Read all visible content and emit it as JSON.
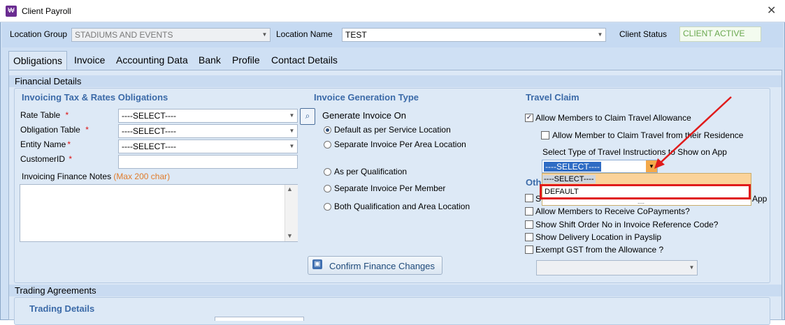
{
  "window": {
    "title": "Client Payroll",
    "close_glyph": "✕"
  },
  "topbar": {
    "location_group_label": "Location Group",
    "location_group_value": "STADIUMS AND EVENTS",
    "location_name_label": "Location Name",
    "location_name_value": "TEST",
    "client_status_label": "Client Status",
    "client_status_value": "CLIENT ACTIVE"
  },
  "tabs": [
    {
      "label": "Obligations",
      "active": true
    },
    {
      "label": "Invoice"
    },
    {
      "label": "Accounting Data"
    },
    {
      "label": "Bank"
    },
    {
      "label": "Profile"
    },
    {
      "label": "Contact Details"
    }
  ],
  "financial": {
    "section_title": "Financial Details",
    "tax_group_title": "Invoicing Tax & Rates Obligations",
    "rate_table_label": "Rate Table",
    "rate_table_value": "----SELECT----",
    "obligation_table_label": "Obligation Table",
    "obligation_table_value": "----SELECT----",
    "entity_name_label": "Entity Name",
    "entity_name_value": "----SELECT----",
    "customer_id_label": "CustomerID",
    "customer_id_value": "",
    "required_mark": "*",
    "notes_label": "Invoicing Finance Notes",
    "notes_hint": "(Max 200 char)",
    "notes_value": "",
    "confirm_button": "Confirm Finance Changes"
  },
  "invoice_generation": {
    "title": "Invoice Generation Type",
    "subtitle": "Generate Invoice On",
    "options": [
      {
        "label": "Default as per Service Location",
        "selected": true
      },
      {
        "label": "Separate Invoice Per Area Location",
        "selected": false
      },
      {
        "label": "As per Qualification",
        "selected": false
      },
      {
        "label": "Separate Invoice Per Member",
        "selected": false
      },
      {
        "label": "Both Qualification and Area Location",
        "selected": false
      }
    ]
  },
  "travel_claim": {
    "title": "Travel Claim",
    "allow_travel_label": "Allow Members to Claim Travel Allowance",
    "allow_travel_checked": true,
    "allow_residence_label": "Allow Member to Claim Travel from their Residence",
    "allow_residence_checked": false,
    "instruction_label": "Select Type of Travel Instructions to Show on App",
    "instruction_value": "----SELECT----",
    "dropdown_options": [
      "----SELECT----",
      "DEFAULT"
    ],
    "dropdown_more": "....",
    "highlight_color": "#e01b1b"
  },
  "other": {
    "title_fragment": "Oth",
    "partial_prefix": "S",
    "partial_suffix": "App",
    "checks": [
      {
        "label": "Allow Members to Receive CoPayments?",
        "checked": false
      },
      {
        "label": "Show Shift Order No in Invoice Reference Code?",
        "checked": false
      },
      {
        "label": "Show Delivery Location in Payslip",
        "checked": false
      },
      {
        "label": "Exempt GST from the Allowance ?",
        "checked": false
      }
    ],
    "allowance_select_value": ""
  },
  "trading": {
    "section_title": "Trading Agreements",
    "details_title": "Trading Details"
  }
}
